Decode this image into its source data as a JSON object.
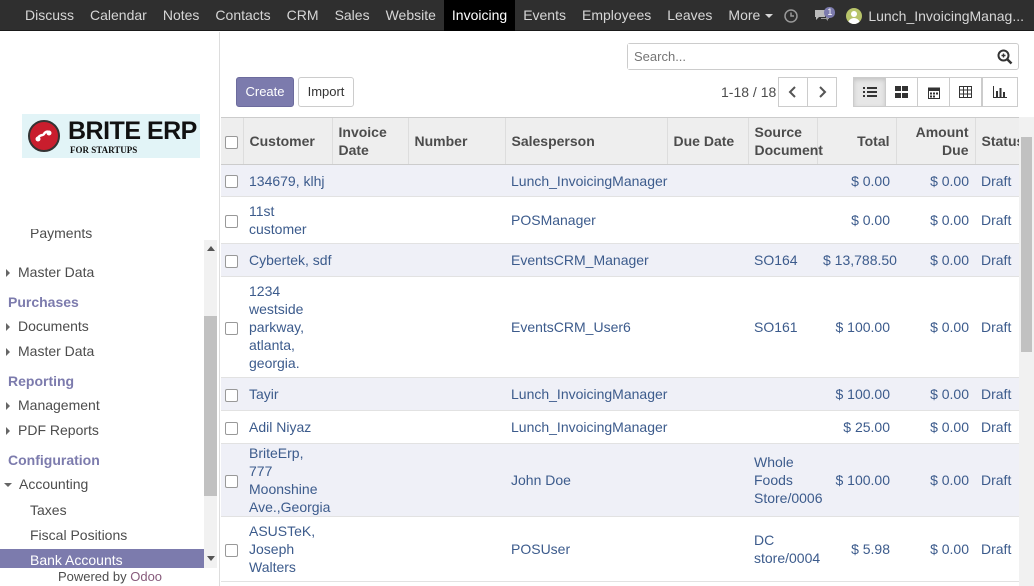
{
  "topbar": {
    "menu": [
      "Discuss",
      "Calendar",
      "Notes",
      "Contacts",
      "CRM",
      "Sales",
      "Website",
      "Invoicing",
      "Events",
      "Employees",
      "Leaves",
      "More"
    ],
    "active": "Invoicing",
    "badge": "1",
    "user": "Lunch_InvoicingManag..."
  },
  "sidebar": {
    "logo_big": "BRITE ERP",
    "logo_small": "FOR STARTUPS",
    "items": {
      "payments": "Payments",
      "master_data_1": "Master Data",
      "purchases": "Purchases",
      "documents": "Documents",
      "master_data_2": "Master Data",
      "reporting": "Reporting",
      "management": "Management",
      "pdf_reports": "PDF Reports",
      "configuration": "Configuration",
      "accounting": "Accounting",
      "taxes": "Taxes",
      "fiscal_positions": "Fiscal Positions",
      "bank_accounts": "Bank Accounts"
    },
    "powered_by": "Powered by",
    "odoo": "Odoo"
  },
  "controls": {
    "create": "Create",
    "import": "Import",
    "search_placeholder": "Search...",
    "pager": "1-18 / 18"
  },
  "table": {
    "headers": {
      "customer": "Customer",
      "invoice_date": "Invoice Date",
      "number": "Number",
      "salesperson": "Salesperson",
      "due_date": "Due Date",
      "source_document": "Source Document",
      "total": "Total",
      "amount_due": "Amount Due",
      "status": "Status"
    },
    "rows": [
      {
        "customer": "134679, klhj",
        "salesperson": "Lunch_InvoicingManager",
        "source": "",
        "total": "$ 0.00",
        "due": "$ 0.00",
        "status": "Draft"
      },
      {
        "customer": "11st customer",
        "salesperson": "POSManager",
        "source": "",
        "total": "$ 0.00",
        "due": "$ 0.00",
        "status": "Draft"
      },
      {
        "customer": "Cybertek, sdf",
        "salesperson": "EventsCRM_Manager",
        "source": "SO164",
        "total": "$ 13,788.50",
        "due": "$ 0.00",
        "status": "Draft"
      },
      {
        "customer": "1234 westside parkway, atlanta, georgia.",
        "salesperson": "EventsCRM_User6",
        "source": "SO161",
        "total": "$ 100.00",
        "due": "$ 0.00",
        "status": "Draft"
      },
      {
        "customer": "Tayir",
        "salesperson": "Lunch_InvoicingManager",
        "source": "",
        "total": "$ 100.00",
        "due": "$ 0.00",
        "status": "Draft"
      },
      {
        "customer": "Adil Niyaz",
        "salesperson": "Lunch_InvoicingManager",
        "source": "",
        "total": "$ 25.00",
        "due": "$ 0.00",
        "status": "Draft"
      },
      {
        "customer": "BriteErp, 777 Moonshine Ave.,Georgia",
        "salesperson": "John Doe",
        "source": "Whole Foods Store/0006",
        "total": "$ 100.00",
        "due": "$ 0.00",
        "status": "Draft"
      },
      {
        "customer": "ASUSTeK, Joseph Walters",
        "salesperson": "POSUser",
        "source": "DC store/0004",
        "total": "$ 5.98",
        "due": "$ 0.00",
        "status": "Draft"
      }
    ]
  }
}
